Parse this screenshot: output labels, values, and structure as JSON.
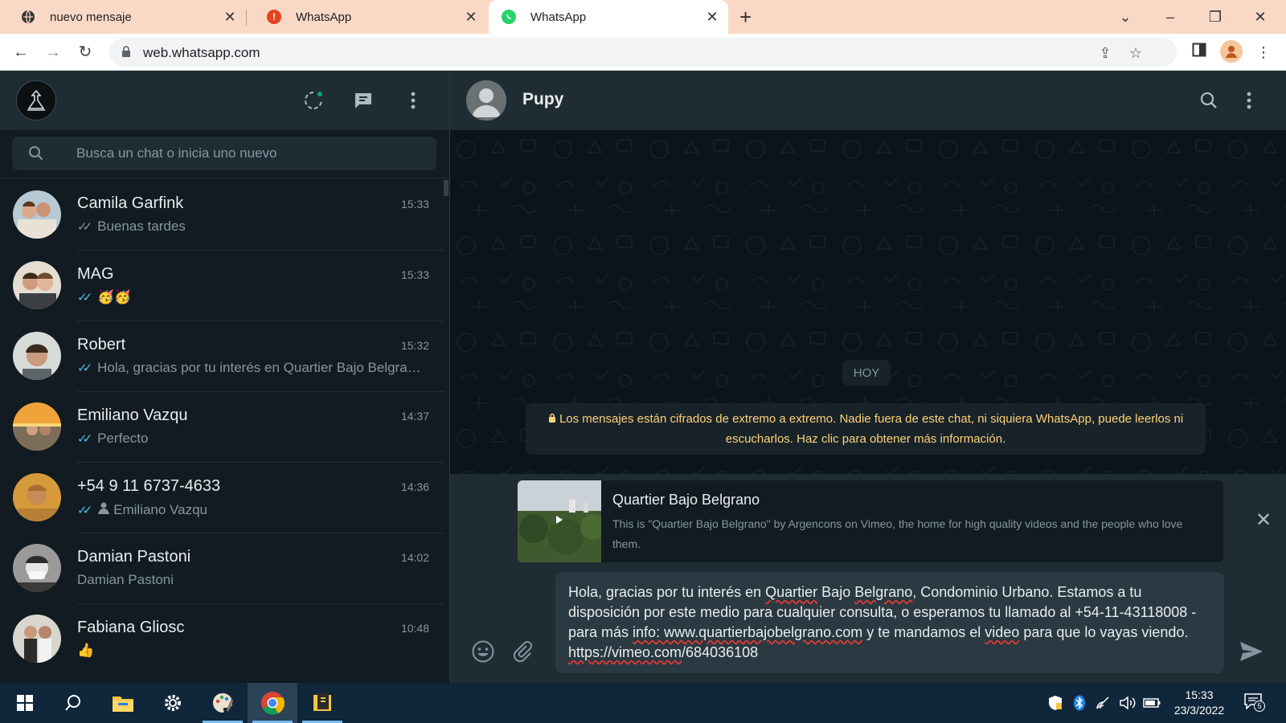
{
  "browser": {
    "tabs": [
      {
        "title": "nuevo mensaje"
      },
      {
        "title": "WhatsApp"
      },
      {
        "title": "WhatsApp"
      }
    ],
    "url": "web.whatsapp.com"
  },
  "colors": {
    "tabstrip": "#f9d9c6",
    "wa_header": "#202c33",
    "wa_bg": "#111b21",
    "read_ticks": "#53bdeb",
    "encryption_text": "#ffd279"
  },
  "sidebar": {
    "search_placeholder": "Busca un chat o inicia uno nuevo",
    "chats": [
      {
        "name": "Camila Garfink",
        "time": "15:33",
        "preview": "Buenas tardes",
        "ticks": true
      },
      {
        "name": "MAG",
        "time": "15:33",
        "preview": "🥳🥳",
        "ticks": true
      },
      {
        "name": "Robert",
        "time": "15:32",
        "preview": "Hola, gracias por tu interés en Quartier Bajo Belgrano, Condominio Urbano.",
        "ticks": true
      },
      {
        "name": "Emiliano Vazqu",
        "time": "14:37",
        "preview": "Perfecto",
        "ticks": true
      },
      {
        "name": "+54 9 11 6737-4633",
        "time": "14:36",
        "preview": "Emiliano Vazqu",
        "ticks": true,
        "contact": true
      },
      {
        "name": "Damian Pastoni",
        "time": "14:02",
        "preview": "Damian Pastoni",
        "ticks": false
      },
      {
        "name": "Fabiana Gliosc",
        "time": "10:48",
        "preview": "👍",
        "ticks": false
      }
    ]
  },
  "conversation": {
    "contact_name": "Pupy",
    "date_chip": "HOY",
    "encryption_notice": "Los mensajes están cifrados de extremo a extremo. Nadie fuera de este chat, ni siquiera WhatsApp, puede leerlos ni escucharlos. Haz clic para obtener más información.",
    "link_preview": {
      "title": "Quartier Bajo Belgrano",
      "description": "This is \"Quartier Bajo Belgrano\" by Argencons on Vimeo, the home for high quality videos and the people who love them."
    },
    "draft": {
      "p1": "Hola, gracias por tu interés en ",
      "w1": "Quartier",
      "p2": " Bajo ",
      "w2": "Belgrano",
      "p3": ", Condominio Urbano. Estamos a tu disposición por este medio para cualquier consulta, o esperamos tu llamado al +54-11-43118008  - para más ",
      "w3": "info: www.quartierbajobelgrano.com",
      "p4": " y te mandamos el ",
      "w4": "video",
      "p5": " para que lo vayas viendo. ",
      "w5": "https://vimeo.com",
      "p6": "/684036108"
    }
  },
  "taskbar": {
    "time": "15:33",
    "date": "23/3/2022",
    "notification_count": "5"
  }
}
